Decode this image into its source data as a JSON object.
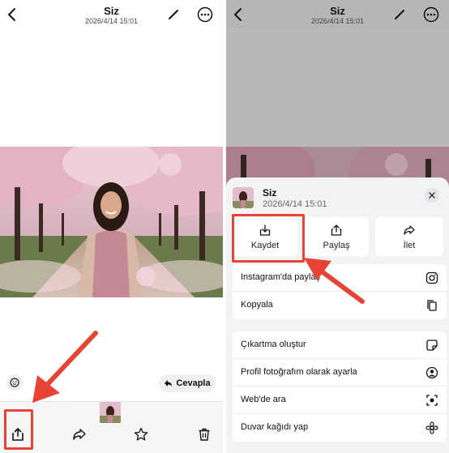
{
  "header": {
    "title": "Siz",
    "timestamp": "2026/4/14 15:01"
  },
  "left": {
    "reply_label": "Cevapla"
  },
  "sheet": {
    "name": "Siz",
    "date": "2026/4/14 15:01",
    "actions": [
      {
        "label": "Kaydet",
        "icon": "download-icon"
      },
      {
        "label": "Paylaş",
        "icon": "share-icon"
      },
      {
        "label": "İlet",
        "icon": "forward-icon"
      }
    ],
    "group1": [
      {
        "label": "Instagram'da paylaş",
        "icon": "instagram-icon"
      },
      {
        "label": "Kopyala",
        "icon": "copy-icon"
      }
    ],
    "group2": [
      {
        "label": "Çıkartma oluştur",
        "icon": "sticker-icon"
      },
      {
        "label": "Profil fotoğrafım olarak ayarla",
        "icon": "profile-icon"
      },
      {
        "label": "Web'de ara",
        "icon": "lens-search-icon"
      },
      {
        "label": "Duvar kağıdı yap",
        "icon": "wallpaper-icon"
      }
    ]
  },
  "colors": {
    "annotation": "#e84436",
    "sheet_bg": "#f2f3f5",
    "overlay": "#b8b8b8"
  }
}
